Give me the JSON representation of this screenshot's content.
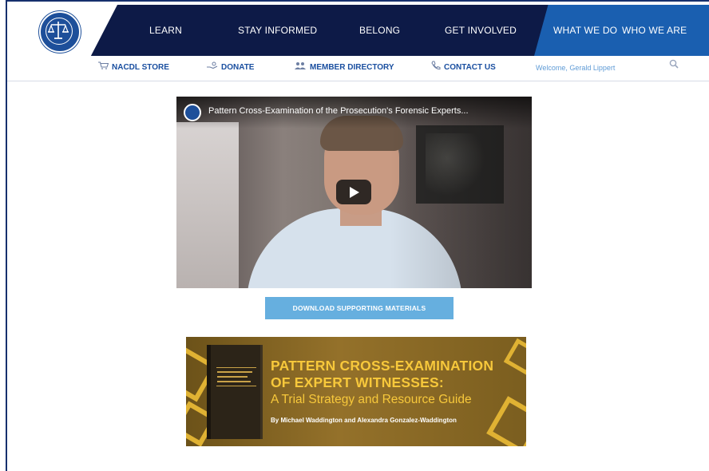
{
  "nav": {
    "items": [
      {
        "label": "LEARN"
      },
      {
        "label": "STAY INFORMED"
      },
      {
        "label": "BELONG"
      },
      {
        "label": "GET INVOLVED"
      },
      {
        "label": "WHAT WE DO"
      },
      {
        "label": "WHO WE ARE"
      }
    ]
  },
  "subnav": {
    "store": "NACDL STORE",
    "donate": "DONATE",
    "directory": "MEMBER DIRECTORY",
    "contact": "CONTACT US",
    "welcome": "Welcome, Gerald Lippert"
  },
  "video": {
    "title": "Pattern Cross-Examination of the Prosecution's Forensic Experts..."
  },
  "download": {
    "label": "DOWNLOAD SUPPORTING MATERIALS"
  },
  "banner": {
    "title_line1": "PATTERN CROSS-EXAMINATION",
    "title_line2": "OF EXPERT WITNESSES:",
    "subtitle": "A Trial Strategy and Resource Guide",
    "authors": "By Michael Waddington and Alexandra Gonzalez-Waddington"
  },
  "colors": {
    "nav_dark": "#0d1a47",
    "nav_accent": "#1a5fb0",
    "link_blue": "#1a4fa0",
    "button_blue": "#66afdf",
    "banner_gold": "#f7c83b"
  }
}
